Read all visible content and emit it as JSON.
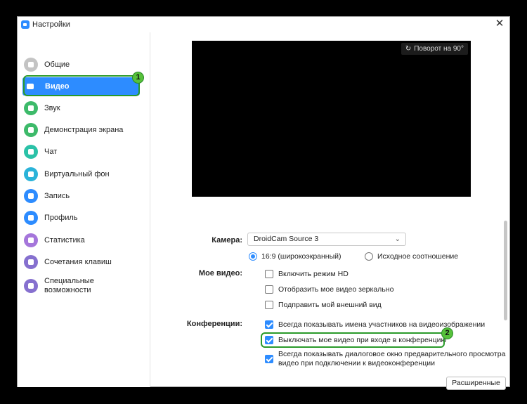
{
  "window": {
    "title": "Настройки"
  },
  "sidebar": {
    "items": [
      {
        "label": "Общие",
        "icon": "gear-icon",
        "color": "#c4c4c4"
      },
      {
        "label": "Видео",
        "icon": "camera-icon",
        "color": "#2d8cff"
      },
      {
        "label": "Звук",
        "icon": "headphones-icon",
        "color": "#3dba6a"
      },
      {
        "label": "Демонстрация экрана",
        "icon": "screen-share-icon",
        "color": "#3dba6a"
      },
      {
        "label": "Чат",
        "icon": "chat-icon",
        "color": "#2bc2a8"
      },
      {
        "label": "Виртуальный фон",
        "icon": "virtual-background-icon",
        "color": "#2bb3d9"
      },
      {
        "label": "Запись",
        "icon": "record-icon",
        "color": "#2d8cff"
      },
      {
        "label": "Профиль",
        "icon": "profile-icon",
        "color": "#2d8cff"
      },
      {
        "label": "Статистика",
        "icon": "statistics-icon",
        "color": "#a576db"
      },
      {
        "label": "Сочетания клавиш",
        "icon": "keyboard-icon",
        "color": "#8670cf"
      },
      {
        "label": "Специальные возможности",
        "icon": "accessibility-icon",
        "color": "#8670cf"
      }
    ]
  },
  "callouts": {
    "first": "1",
    "second": "2"
  },
  "video": {
    "rotate_label": "Поворот на 90°"
  },
  "camera": {
    "label": "Камера:",
    "value": "DroidCam Source 3"
  },
  "aspect": {
    "wide": "16:9 (широкоэкранный)",
    "original": "Исходное соотношение"
  },
  "my_video": {
    "label": "Мое видео:",
    "hd": "Включить режим HD",
    "mirror": "Отобразить мое видео зеркально",
    "touchup": "Подправить мой внешний вид"
  },
  "conferences": {
    "label": "Конференции:",
    "show_names": "Всегда показывать имена участников на видеоизображении",
    "turn_off": "Выключать мое видео при входе в конференцию",
    "preview_line1": "Всегда показывать диалоговое окно предварительного просмотра",
    "preview_line2": "видео при подключении к видеоконференции"
  },
  "advanced_button": "Расширенные",
  "colors": {
    "accent": "#2d8cff",
    "highlight": "#2a9a2a",
    "badge": "#57c13b"
  }
}
